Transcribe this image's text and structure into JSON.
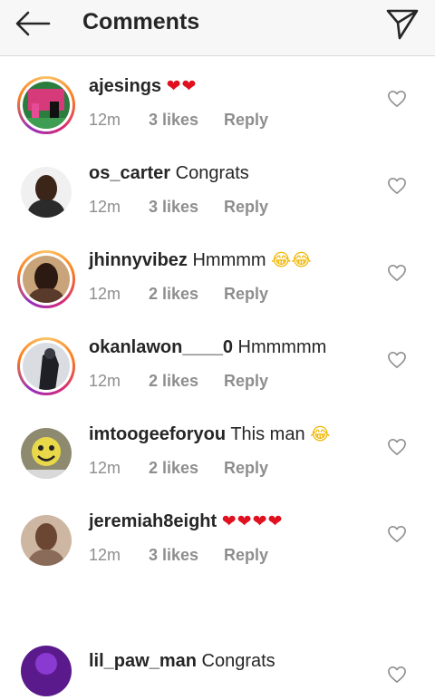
{
  "header": {
    "title": "Comments",
    "back_icon": "arrow-left-icon",
    "send_icon": "paper-plane-icon"
  },
  "comments": [
    {
      "username": "ajesings",
      "text": "",
      "emoji": "❤❤",
      "time": "12m",
      "likes": "3 likes",
      "reply": "Reply",
      "ring": true
    },
    {
      "username": "os_carter",
      "text": "Congrats",
      "emoji": "",
      "time": "12m",
      "likes": "3 likes",
      "reply": "Reply",
      "ring": false
    },
    {
      "username": "jhinnyvibez",
      "text": "Hmmmm",
      "emoji": "😂😂",
      "time": "12m",
      "likes": "2 likes",
      "reply": "Reply",
      "ring": true
    },
    {
      "username": "okanlawon____0",
      "text": "Hmmmmm",
      "emoji": "",
      "time": "12m",
      "likes": "2 likes",
      "reply": "Reply",
      "ring": true
    },
    {
      "username": "imtoogeeforyou",
      "text": "This man",
      "emoji": "😂",
      "time": "12m",
      "likes": "2 likes",
      "reply": "Reply",
      "ring": false
    },
    {
      "username": "jeremiah8eight",
      "text": "",
      "emoji": "❤❤❤❤",
      "time": "12m",
      "likes": "3 likes",
      "reply": "Reply",
      "ring": false
    },
    {
      "username": "lil_paw_man",
      "text": "Congrats",
      "emoji": "",
      "time": "",
      "likes": "",
      "reply": "",
      "ring": false
    }
  ],
  "colors": {
    "text": "#262626",
    "meta": "#8e8e8e",
    "heart_red": "#e0101e",
    "story_ring": "#d62976"
  }
}
